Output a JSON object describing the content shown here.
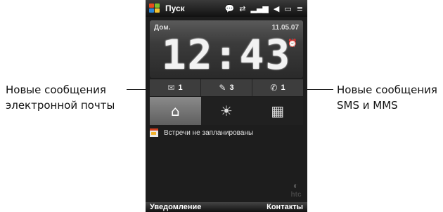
{
  "callouts": {
    "left": [
      "Новые сообщения",
      "электронной почты"
    ],
    "right": [
      "Новые сообщения",
      "SMS и MMS"
    ]
  },
  "status_bar": {
    "title": "Пуск",
    "icons": [
      "chat-icon",
      "sync-icon",
      "signal-icon",
      "volume-icon",
      "battery-icon",
      "menu-icon"
    ]
  },
  "clock": {
    "location": "Дом.",
    "date": "11.05.07",
    "time": "12:43"
  },
  "notifications": [
    {
      "icon": "email-icon",
      "count": "1"
    },
    {
      "icon": "sms-icon",
      "count": "3"
    },
    {
      "icon": "missed-call-icon",
      "count": "1"
    }
  ],
  "tabs": [
    "home-icon",
    "weather-icon",
    "apps-icon"
  ],
  "agenda": {
    "text": "Встречи не запланированы"
  },
  "brand": {
    "logo": "htc"
  },
  "softkeys": {
    "left": "Уведомление",
    "right": "Контакты"
  }
}
